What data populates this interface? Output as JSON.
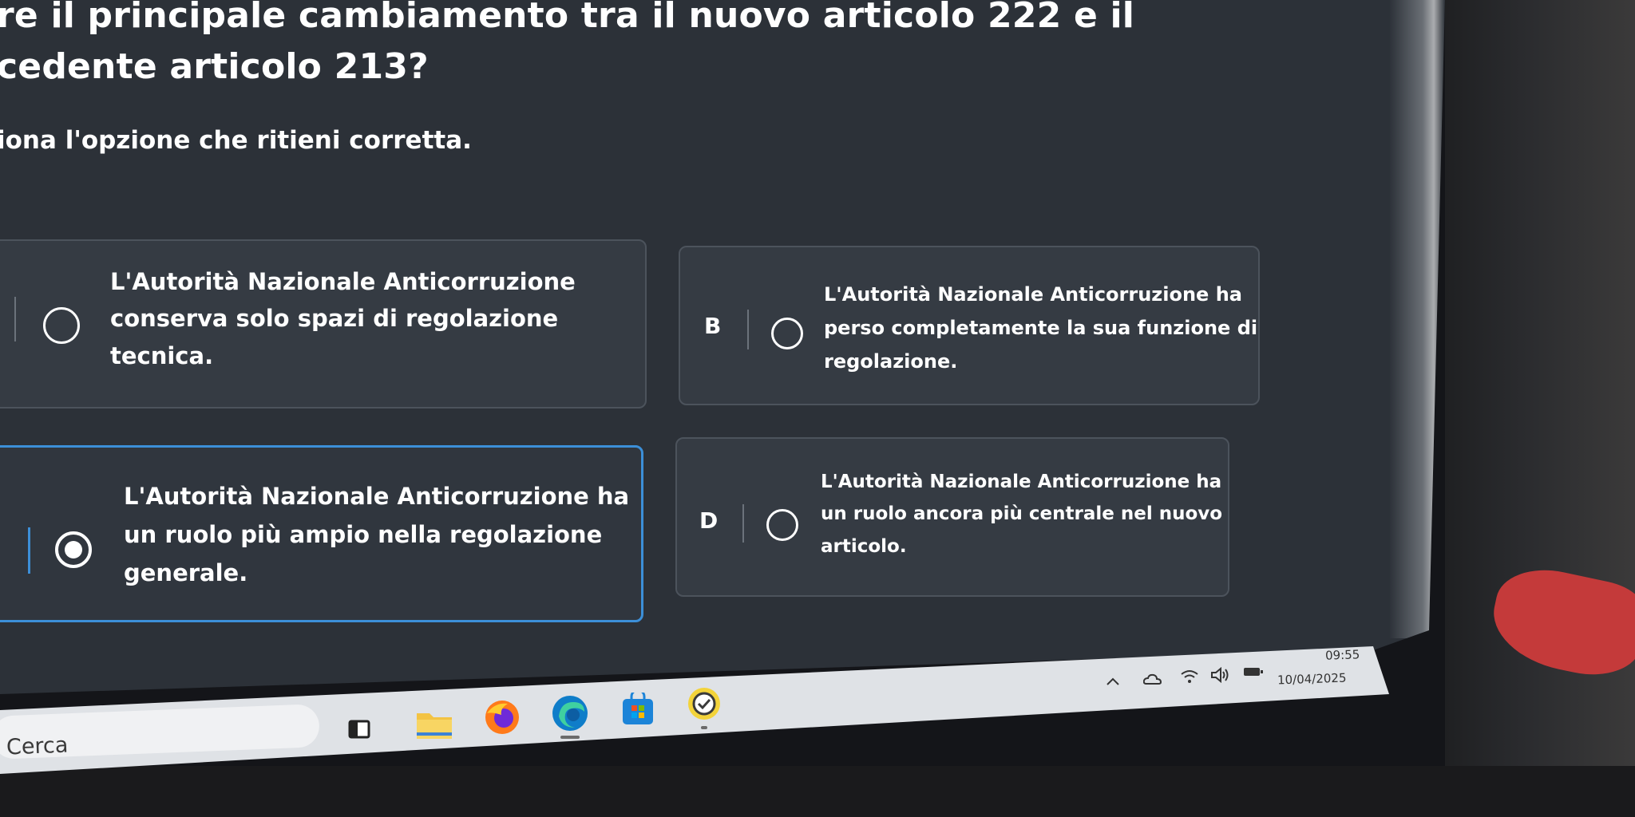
{
  "question": {
    "line1": "re il principale cambiamento tra il nuovo articolo 222 e il",
    "line2": "cedente articolo 213?",
    "instruction": "iona l'opzione che ritieni corretta."
  },
  "options": [
    {
      "letter": "",
      "lines": [
        "L'Autorità Nazionale Anticorruzione",
        "conserva solo spazi di regolazione",
        "tecnica."
      ],
      "selected": false
    },
    {
      "letter": "B",
      "lines": [
        "L'Autorità Nazionale Anticorruzione ha",
        "perso completamente la sua funzione di",
        "regolazione."
      ],
      "selected": false
    },
    {
      "letter": "",
      "lines": [
        "L'Autorità Nazionale Anticorruzione ha",
        "un ruolo più ampio nella regolazione",
        "generale."
      ],
      "selected": true
    },
    {
      "letter": "D",
      "lines": [
        "L'Autorità Nazionale Anticorruzione ha",
        "un ruolo ancora più centrale nel nuovo",
        "articolo."
      ],
      "selected": false
    }
  ],
  "taskbar": {
    "search_placeholder": "Cerca",
    "apps": [
      "task-view-icon",
      "file-explorer-icon",
      "firefox-icon",
      "edge-icon",
      "microsoft-store-icon",
      "checklist-app-icon"
    ],
    "tray_icons": [
      "chevron-up-icon",
      "onedrive-icon",
      "wifi-icon",
      "speaker-icon",
      "battery-icon"
    ],
    "time": "09:55",
    "date": "10/04/2025"
  },
  "colors": {
    "screen_bg": "#2c3138",
    "option_bg": "#353b43",
    "selected_border": "#3c8fd8"
  }
}
